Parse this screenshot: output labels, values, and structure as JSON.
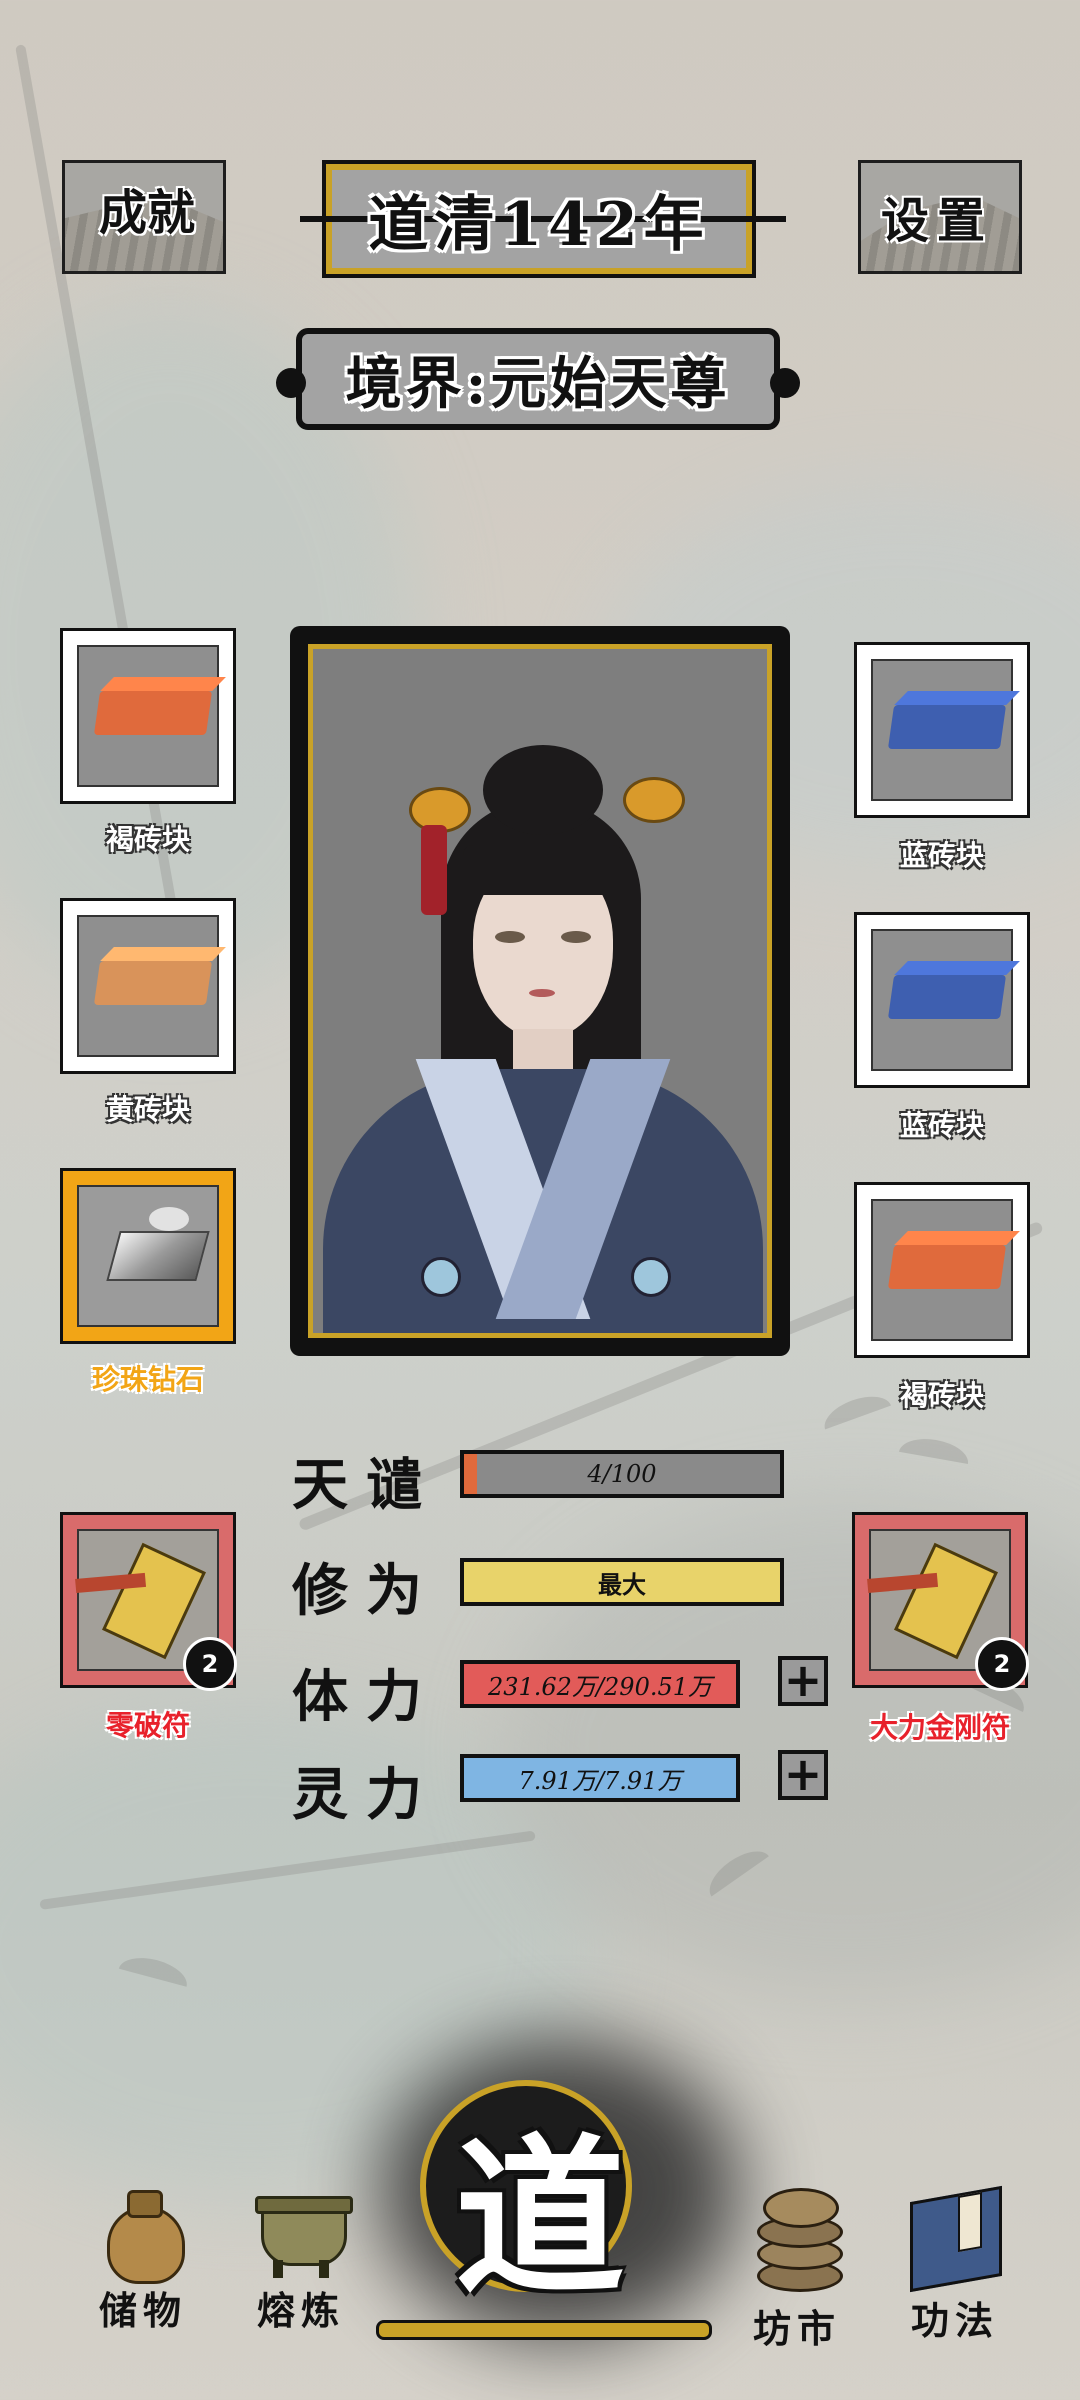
{
  "header": {
    "achievements_label": "成就",
    "settings_label": "设置",
    "year_title": "道清142年",
    "realm_title": "境界:元始天尊"
  },
  "equipment": {
    "left": [
      {
        "label": "褐砖块",
        "icon": "brown-brick-icon",
        "color": "#e06a3c"
      },
      {
        "label": "黄砖块",
        "icon": "tan-brick-icon",
        "color": "#d9935a"
      },
      {
        "label": "珍珠钻石",
        "icon": "pearl-diamond-icon",
        "color": "#f2a516"
      }
    ],
    "right": [
      {
        "label": "蓝砖块",
        "icon": "blue-brick-icon",
        "color": "#3e5fb0"
      },
      {
        "label": "蓝砖块",
        "icon": "blue-brick-icon",
        "color": "#3e5fb0"
      },
      {
        "label": "褐砖块",
        "icon": "brown-brick-icon",
        "color": "#e06a3c"
      }
    ]
  },
  "talismans": {
    "left": {
      "label": "零破符",
      "count": "2",
      "icon": "talisman-icon"
    },
    "right": {
      "label": "大力金刚符",
      "count": "2",
      "icon": "talisman-icon"
    }
  },
  "stats": {
    "tianqian": {
      "label": "天谴",
      "value": "4/100",
      "fraction": 0.04,
      "color": "#e06a3c"
    },
    "xiuwei": {
      "label": "修为",
      "value": "最大",
      "fraction": 1.0,
      "color": "#e8d36a"
    },
    "tili": {
      "label": "体力",
      "value": "231.62万/290.51万",
      "fraction": 1.0,
      "color": "#e25b59"
    },
    "lingli": {
      "label": "灵力",
      "value": "7.91万/7.91万",
      "fraction": 1.0,
      "color": "#7fb5e3"
    }
  },
  "nav": {
    "storage": "储物",
    "smelting": "熔炼",
    "dao": "道",
    "market": "坊市",
    "skills": "功法"
  },
  "colors": {
    "gold": "#c9a227",
    "rare_label": "#f2a516",
    "talisman_label": "#e8212b"
  }
}
